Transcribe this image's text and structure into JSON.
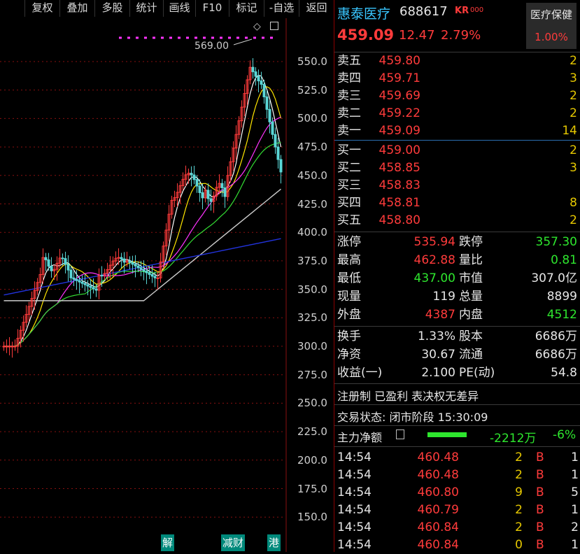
{
  "toolbar": {
    "buttons": [
      "复权",
      "叠加",
      "多股",
      "统计",
      "画线",
      "F10",
      "标记",
      "-自选",
      "返回"
    ]
  },
  "header": {
    "name": "惠泰医疗",
    "code": "688617",
    "tag": "KR",
    "tag_suffix": "000",
    "price": "459.09",
    "change": "12.47",
    "change_pct": "2.79%",
    "sector_name": "医疗保健",
    "sector_pct": "1.00%"
  },
  "chart": {
    "price_marker": "569.00",
    "y_ticks": [
      "550.0",
      "525.0",
      "500.0",
      "475.0",
      "450.0",
      "425.0",
      "400.0",
      "375.0",
      "350.0",
      "325.0",
      "300.0",
      "275.0",
      "250.0",
      "225.0",
      "200.0",
      "175.0",
      "150.0"
    ],
    "markers": [
      "解",
      "减财",
      "港"
    ]
  },
  "asks": [
    {
      "label": "卖五",
      "price": "459.80",
      "vol": "2"
    },
    {
      "label": "卖四",
      "price": "459.71",
      "vol": "3"
    },
    {
      "label": "卖三",
      "price": "459.69",
      "vol": "2"
    },
    {
      "label": "卖二",
      "price": "459.22",
      "vol": "2"
    },
    {
      "label": "卖一",
      "price": "459.09",
      "vol": "14"
    }
  ],
  "bids": [
    {
      "label": "买一",
      "price": "459.00",
      "vol": "2"
    },
    {
      "label": "买二",
      "price": "458.85",
      "vol": "3"
    },
    {
      "label": "买三",
      "price": "458.83",
      "vol": ""
    },
    {
      "label": "买四",
      "price": "458.81",
      "vol": "8"
    },
    {
      "label": "买五",
      "price": "458.80",
      "vol": "2"
    }
  ],
  "stats": [
    {
      "l1": "涨停",
      "v1": "535.94",
      "c1": "red",
      "l2": "跌停",
      "v2": "357.30",
      "c2": "green"
    },
    {
      "l1": "最高",
      "v1": "462.88",
      "c1": "red",
      "l2": "量比",
      "v2": "0.81",
      "c2": "green"
    },
    {
      "l1": "最低",
      "v1": "437.00",
      "c1": "green",
      "l2": "市值",
      "v2": "307.0亿",
      "c2": "white"
    },
    {
      "l1": "现量",
      "v1": "119",
      "c1": "white",
      "l2": "总量",
      "v2": "8899",
      "c2": "white"
    },
    {
      "l1": "外盘",
      "v1": "4387",
      "c1": "red",
      "l2": "内盘",
      "v2": "4512",
      "c2": "green"
    }
  ],
  "stats2": [
    {
      "l1": "换手",
      "v1": "1.33%",
      "l2": "股本",
      "v2": "6686万"
    },
    {
      "l1": "净资",
      "v1": "30.67",
      "l2": "流通",
      "v2": "6686万"
    },
    {
      "l1": "收益(一)",
      "v1": "2.100",
      "l2": "PE(动)",
      "v2": "54.8"
    }
  ],
  "info": {
    "flags": "注册制 已盈利 表决权无差异",
    "status": "交易状态: 闭市阶段 15:30:09"
  },
  "main_flow": {
    "label": "主力净额",
    "amount": "-2212万",
    "pct": "-6%"
  },
  "ticks": [
    {
      "time": "14:54",
      "price": "460.48",
      "vol": "2",
      "side": "B",
      "n": "1"
    },
    {
      "time": "14:54",
      "price": "460.48",
      "vol": "2",
      "side": "B",
      "n": "1"
    },
    {
      "time": "14:54",
      "price": "460.80",
      "vol": "9",
      "side": "B",
      "n": "5"
    },
    {
      "time": "14:54",
      "price": "460.79",
      "vol": "2",
      "side": "B",
      "n": "1"
    },
    {
      "time": "14:54",
      "price": "460.84",
      "vol": "2",
      "side": "B",
      "n": "2"
    },
    {
      "time": "14:54",
      "price": "460.84",
      "vol": "0",
      "side": "B",
      "n": "1"
    }
  ],
  "colors": {
    "up": "#ff3b3b",
    "down": "#2ee62e",
    "ma5": "#ffffff",
    "ma10": "#ffe600",
    "ma20": "#ff33ff",
    "ma30": "#33dd33",
    "ma60": "#cccccc",
    "ma120": "#2233dd",
    "name": "#39c6ff"
  }
}
